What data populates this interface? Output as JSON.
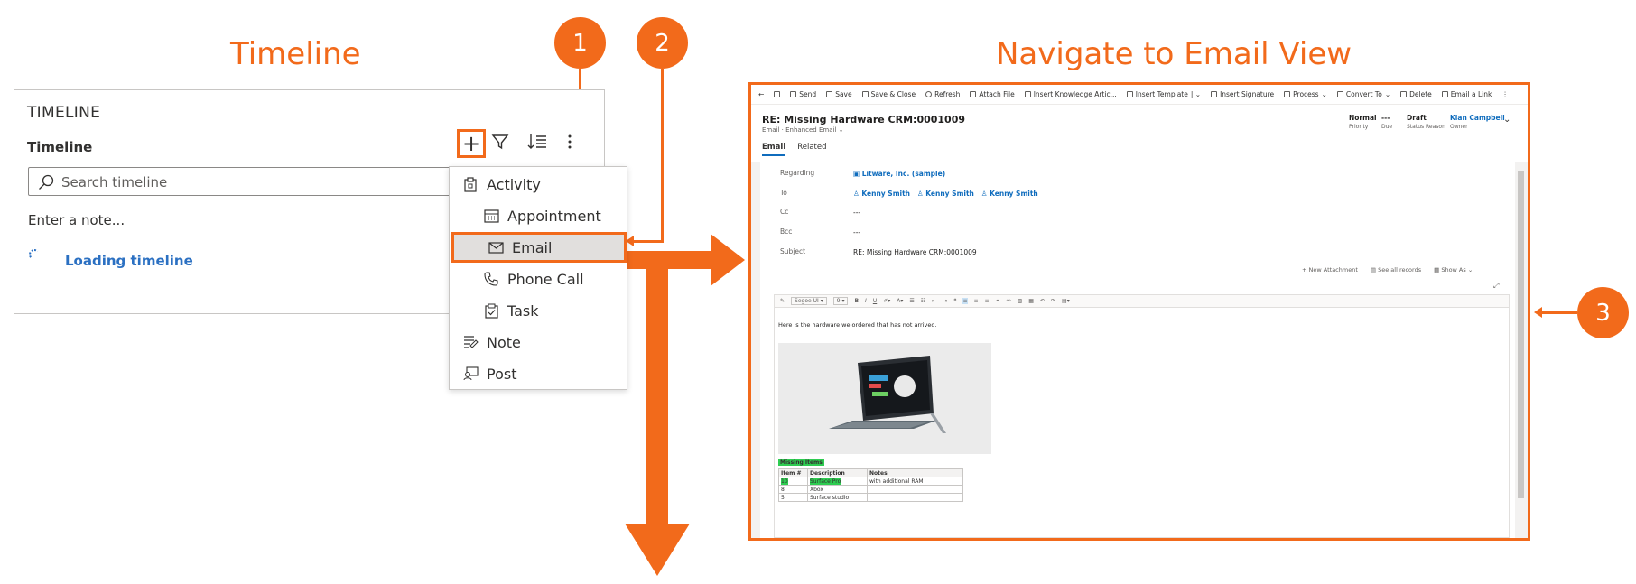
{
  "headings": {
    "left": "Timeline",
    "right": "Navigate to Email View"
  },
  "badges": [
    "1",
    "2",
    "3"
  ],
  "colors": {
    "accent": "#f26a1b",
    "link": "#2b70c2"
  },
  "timeline": {
    "panel_title": "TIMELINE",
    "section_title": "Timeline",
    "search_placeholder": "Search timeline",
    "note_placeholder": "Enter a note...",
    "loading_text": "Loading timeline",
    "tools": [
      "plus-icon",
      "filter-icon",
      "sort-icon",
      "more-icon"
    ]
  },
  "menu": {
    "items": [
      {
        "label": "Activity",
        "icon": "clipboard-icon"
      },
      {
        "label": "Appointment",
        "icon": "calendar-icon"
      },
      {
        "label": "Email",
        "icon": "mail-icon",
        "selected": true
      },
      {
        "label": "Phone Call",
        "icon": "phone-icon"
      },
      {
        "label": "Task",
        "icon": "task-icon"
      },
      {
        "label": "Note",
        "icon": "note-icon"
      },
      {
        "label": "Post",
        "icon": "post-icon"
      }
    ]
  },
  "email": {
    "commands": [
      "Send",
      "Save",
      "Save & Close",
      "Refresh",
      "Attach File",
      "Insert Knowledge Artic...",
      "Insert Template",
      "Insert Signature",
      "Process",
      "Convert To",
      "Delete",
      "Email a Link"
    ],
    "title": "RE: Missing Hardware CRM:0001009",
    "subtitle_entity": "Email",
    "subtitle_form": "Enhanced Email",
    "header_fields": [
      {
        "value": "Normal",
        "label": "Priority"
      },
      {
        "value": "---",
        "label": "Due"
      },
      {
        "value": "Draft",
        "label": "Status Reason"
      },
      {
        "value": "Kian Campbell",
        "label": "Owner"
      }
    ],
    "tabs": [
      "Email",
      "Related"
    ],
    "fields": {
      "regarding_label": "Regarding",
      "regarding_value": "Litware, Inc. (sample)",
      "to_label": "To",
      "to_values": [
        "Kenny Smith",
        "Kenny Smith",
        "Kenny Smith"
      ],
      "cc_label": "Cc",
      "cc_value": "---",
      "bcc_label": "Bcc",
      "bcc_value": "---",
      "subject_label": "Subject",
      "subject_value": "RE: Missing Hardware CRM:0001009"
    },
    "attachment_actions": [
      "New Attachment",
      "See all records",
      "Show As"
    ],
    "editor": {
      "font": "Segoe UI",
      "size": "9",
      "body_text": "Here is the hardware we ordered that has not arrived.",
      "missing_title": "Missing Items",
      "table_headers": [
        "Item #",
        "Description",
        "Notes"
      ],
      "table_rows": [
        [
          "10",
          "Surface Pro",
          "with additional RAM"
        ],
        [
          "8",
          "Xbox",
          ""
        ],
        [
          "5",
          "Surface studio",
          ""
        ]
      ]
    }
  }
}
